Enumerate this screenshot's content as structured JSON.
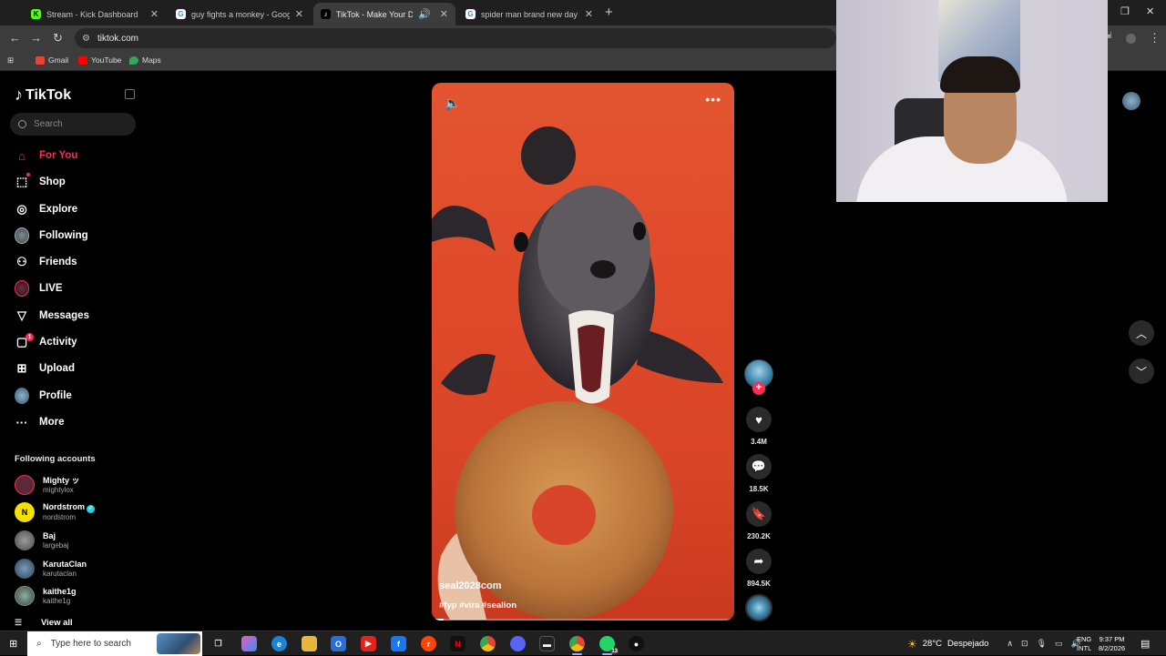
{
  "browser": {
    "tabs": [
      {
        "title": "Stream - Kick Dashboard",
        "fav_color": "#53fc18",
        "fav_glyph": "K"
      },
      {
        "title": "guy fights a monkey - Google S",
        "fav_color": "#ffffff",
        "fav_glyph": "G"
      },
      {
        "title": "TikTok - Make Your Day",
        "fav_color": "#000000",
        "fav_glyph": "♪"
      },
      {
        "title": "spider man brand new day - Go",
        "fav_color": "#ffffff",
        "fav_glyph": "G"
      }
    ],
    "url": "tiktok.com",
    "bookmarks": [
      {
        "label": "Gmail",
        "color": "#ea4335"
      },
      {
        "label": "YouTube",
        "color": "#ff0000"
      },
      {
        "label": "Maps",
        "color": "#34a853"
      }
    ]
  },
  "tiktok": {
    "logo": "TikTok",
    "search_placeholder": "Search",
    "nav": [
      {
        "label": "For You",
        "icon": "home-icon",
        "glyph": "⌂"
      },
      {
        "label": "Shop",
        "icon": "shopping-bag-icon",
        "glyph": "🛍"
      },
      {
        "label": "Explore",
        "icon": "compass-icon",
        "glyph": "◎"
      },
      {
        "label": "Following",
        "icon": "following-avatar-icon",
        "glyph": ""
      },
      {
        "label": "Friends",
        "icon": "friends-icon",
        "glyph": "👥"
      },
      {
        "label": "LIVE",
        "icon": "live-icon",
        "glyph": ""
      },
      {
        "label": "Messages",
        "icon": "messages-icon",
        "glyph": "▽"
      },
      {
        "label": "Activity",
        "icon": "activity-icon",
        "glyph": "▢",
        "badge": "1"
      },
      {
        "label": "Upload",
        "icon": "upload-icon",
        "glyph": "⊞"
      },
      {
        "label": "Profile",
        "icon": "profile-avatar-icon",
        "glyph": ""
      },
      {
        "label": "More",
        "icon": "more-icon",
        "glyph": "···"
      }
    ],
    "following_title": "Following accounts",
    "accounts": [
      {
        "name": "Mighty ッ",
        "handle": "mightylox",
        "verified": false,
        "avatar_color": "#5b2a3a",
        "avatar_text": ""
      },
      {
        "name": "Nordstrom",
        "handle": "nordstrom",
        "verified": true,
        "avatar_color": "#f5e000",
        "avatar_text": "N"
      },
      {
        "name": "Baj",
        "handle": "largebaj",
        "verified": false,
        "avatar_color": "#6b6b6b",
        "avatar_text": ""
      },
      {
        "name": "KarutaClan",
        "handle": "karutaclan",
        "verified": false,
        "avatar_color": "#4a6a8a",
        "avatar_text": ""
      },
      {
        "name": "kaithe1g",
        "handle": "kaithe1g",
        "verified": false,
        "avatar_color": "#5a7a6a",
        "avatar_text": ""
      }
    ],
    "view_all": "View all",
    "video": {
      "author": "seal2028com",
      "tags": "#fyp #vira #sealion",
      "progress": 0.04
    },
    "actions": {
      "likes": "3.4M",
      "comments": "18.5K",
      "saves": "230.2K",
      "shares": "894.5K"
    }
  },
  "taskbar": {
    "search_placeholder": "Type here to search",
    "weather_temp": "28°C",
    "weather_text": "Despejado",
    "lang_1": "ENG",
    "lang_2": "INTL",
    "time": "9:37 PM",
    "date": "8/2/2026",
    "whatsapp_badge": "13"
  }
}
